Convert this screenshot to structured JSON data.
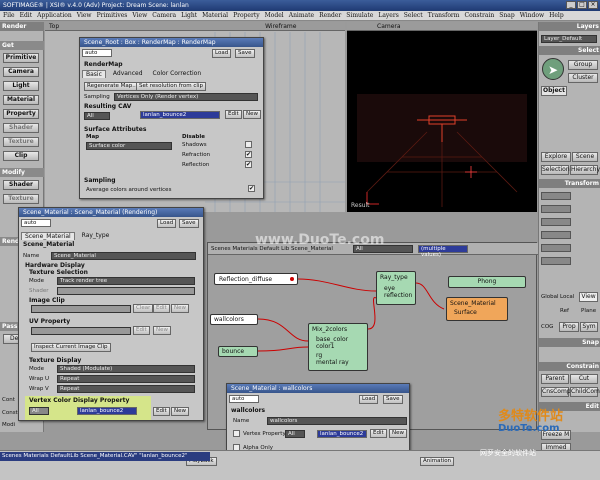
{
  "app": {
    "title": "SOFTIMAGE® | XSI® v.4.0 (Adv) Project: Dream   Scene: lanlan"
  },
  "menu": [
    "File",
    "Edit",
    "Application",
    "View",
    "Primitives",
    "View",
    "Camera",
    "Light",
    "Material",
    "Property",
    "Model",
    "Animate",
    "Render",
    "Simulate",
    "Layers",
    "Select",
    "Transform",
    "Constrain",
    "Snap",
    "Window",
    "Help"
  ],
  "left_panel": {
    "header": "Render",
    "sections": [
      {
        "title": "Get",
        "buttons": [
          "Primitive",
          "Camera",
          "Light",
          "Material",
          "Property",
          "Shader",
          "Texture",
          "Clip"
        ]
      },
      {
        "title": "Modify",
        "buttons": [
          "Shader",
          "Texture"
        ]
      },
      {
        "title": "Render",
        "buttons": []
      },
      {
        "title": "Pass",
        "buttons": [
          "Default"
        ]
      }
    ],
    "misc": [
      "Cont",
      "Constr",
      "Modi"
    ]
  },
  "top_viewport": {
    "label": "Top",
    "wireframe": "Wireframe"
  },
  "camera_viewport": {
    "label": "Camera",
    "result_label": "Result"
  },
  "render_map_window": {
    "title": "Scene_Root : Box : RenderMap : RenderMap",
    "preset": "auto",
    "load_label": "Load",
    "save_label": "Save",
    "section": "RenderMap",
    "tabs": [
      "Basic",
      "Advanced",
      "Color Correction"
    ],
    "regen_btn": "Regenerate Map...",
    "set_res_btn": "Set resolution from clip",
    "sampling_label": "Sampling",
    "sampling_value": "Vertices Only (Render vertex)",
    "resulting_cav": "Resulting CAV",
    "all_label": "All",
    "cav_value": "lanlan_bounce2",
    "edit_label": "Edit",
    "new_label": "New",
    "surface_attrs": "Surface Attributes",
    "map_label": "Map",
    "disable_label": "Disable",
    "map_value": "Surface color",
    "shadows": "Shadows",
    "refraction": "Refraction",
    "reflection": "Reflection",
    "sampling_section": "Sampling",
    "avg_colors": "Average colors around vertices"
  },
  "material_window": {
    "title": "Scene_Material : Scene_Material (Rendering)",
    "preset": "auto",
    "load_label": "Load",
    "save_label": "Save",
    "tabs": [
      "Scene_Material",
      "Ray_type"
    ],
    "section": "Scene_Material",
    "name_label": "Name",
    "name_value": "Scene_Material",
    "hardware_display": "Hardware Display",
    "texture_selection": "Texture Selection",
    "mode_label": "Mode",
    "mode_value": "Track render tree",
    "shader_label": "Shader",
    "image_clip": "Image Clip",
    "clear_label": "Clear",
    "edit_label": "Edit",
    "new_label": "New",
    "uv_property": "UV Property",
    "inspect_clip": "Inspect Current Image Clip",
    "texture_display": "Texture Display",
    "td_mode_value": "Shaded (Modulate)",
    "wrap_u_label": "Wrap U",
    "wrap_u_value": "Repeat",
    "wrap_v_label": "Wrap V",
    "wrap_v_value": "Repeat",
    "vcdp": "Vertex Color Display Property",
    "vcdp_value": "lanlan_bounce2",
    "all_label": "All"
  },
  "render_tree": {
    "header_text": "Scenes Materials Default Lib Scene_Material",
    "all_label": "All",
    "multiple_value": "(multiple values)",
    "nodes": {
      "reflection_diffuse": "Reflection_diffuse",
      "ray_type": "Ray_type",
      "ray_eye": "eye",
      "ray_reflection": "reflection",
      "phong": "Phong",
      "scene_material": "Scene_Material",
      "scene_material_port": "Surface",
      "wallcolors": "wallcolors",
      "mix": "Mix_2colors",
      "mix_ports": [
        "base_color",
        "color1"
      ],
      "mix_foot": [
        "rg",
        "mental ray"
      ],
      "bounce": "bounce"
    }
  },
  "wallcolors_window": {
    "title": "Scene_Material : wallcolors",
    "preset": "auto",
    "load_label": "Load",
    "save_label": "Save",
    "section": "wallcolors",
    "name_label": "Name",
    "name_value": "wallcolors",
    "vertex_property": "Vertex Property",
    "vertex_value": "lanlan_bounce2",
    "alpha_only": "Alpha Only",
    "all_label": "All",
    "edit_label": "Edit",
    "new_label": "New"
  },
  "right_panel": {
    "layers_header": "Layers",
    "layer_default": "Layer_Default",
    "select_header": "Select",
    "group_btn": "Group",
    "cluster_btn": "Cluster",
    "object_btn": "Object",
    "explore": "Explore",
    "scene": "Scene",
    "selection": "Selection",
    "hierarchy": "Hierarchy",
    "transform_header": "Transform",
    "global": "Global",
    "local": "Local",
    "view": "View",
    "ref": "Ref",
    "plane": "Plane",
    "cog": "COG",
    "prop": "Prop",
    "sym": "Sym",
    "snap_header": "Snap",
    "constrain_header": "Constrain",
    "parent": "Parent",
    "cut": "Cut",
    "cnscomp": "CnsComp",
    "childcomp": "ChildComp",
    "edit_header": "Edit",
    "freeze": "Freeze M",
    "immed": "Immed"
  },
  "bottom": {
    "status": "Scenes Materials DefaultLib Scene_Material.CAV\" \"lanlan_bounce2\"",
    "playback": "Playback",
    "animation": "Animation"
  },
  "watermark": {
    "site": "www.DuoTe.com",
    "brand": "多特软件站",
    "brand2": "DuoTe.com",
    "tagline": "网罗安全的软件站"
  },
  "colors": {
    "title_bar": "#2d4a85",
    "node_green": "#a6d9b2",
    "node_orange": "#f0a65a",
    "highlight": "#d5e58a"
  }
}
